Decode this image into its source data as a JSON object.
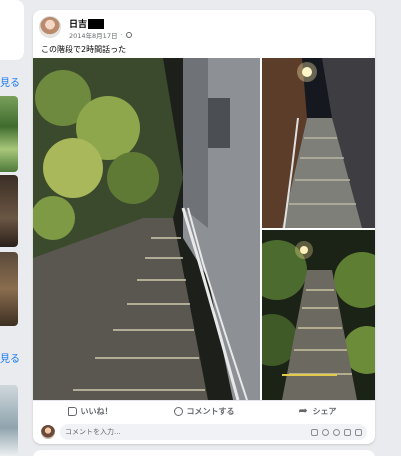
{
  "sidebar": {
    "see_more_1": "見る",
    "see_more_2": "見る"
  },
  "post": {
    "author": "日吉",
    "date": "2014年8月17日",
    "privacy_icon": "globe-icon",
    "caption": "この階段で2時間話った"
  },
  "actions": {
    "like": "いいね！",
    "comment": "コメントする",
    "share": "シェア"
  },
  "comment_box": {
    "placeholder": "コメントを入力..."
  }
}
